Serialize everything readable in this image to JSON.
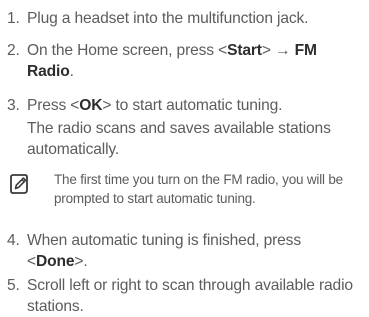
{
  "steps": [
    {
      "num": "1.",
      "text": "Plug a headset into the multifunction jack."
    },
    {
      "num": "2.",
      "pre": "On the Home screen, press <",
      "key1": "Start",
      "mid": "> → ",
      "key2": "FM Radio",
      "post": "."
    },
    {
      "num": "3.",
      "pre": "Press <",
      "key": "OK",
      "post": "> to start automatic tuning.",
      "sub": "The radio scans and saves available stations automatically."
    },
    {
      "num": "4.",
      "pre": "When automatic tuning is finished, press <",
      "key": "Done",
      "post": ">."
    },
    {
      "num": "5.",
      "text": "Scroll left or right to scan through available radio stations."
    }
  ],
  "note": {
    "icon": "note-pencil-icon",
    "text": "The first time you turn on the FM radio, you will be prompted to start automatic tuning."
  }
}
